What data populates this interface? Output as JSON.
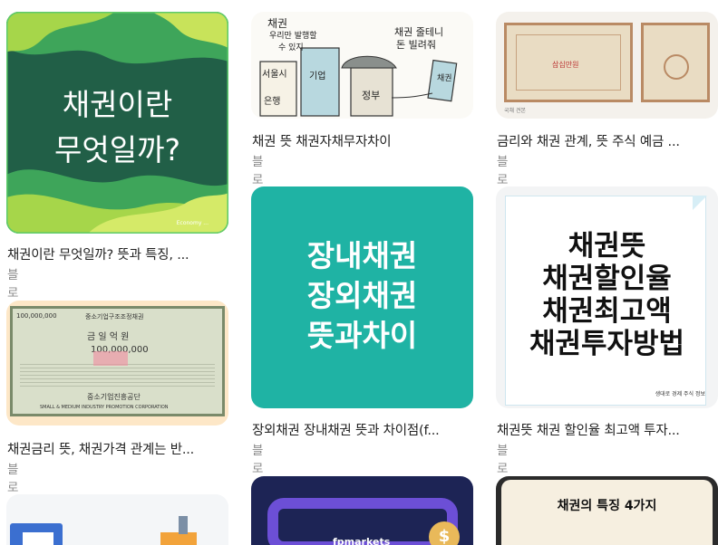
{
  "results": [
    {
      "title": "채권이란 무엇일까? 뜻과 특징, ...",
      "source": "블로그",
      "thumb_text": [
        "채권이란",
        "무엇일까?"
      ],
      "thumb_footer": "Economy ..."
    },
    {
      "title": "채권 뜻 채권자채무자차이",
      "source": "블로그",
      "thumb_labels": [
        "채권",
        "우리만 발행할",
        "수 있지",
        "채권 줄테니",
        "돈 빌려줘",
        "서울시",
        "은행",
        "기업",
        "정부",
        "채권"
      ]
    },
    {
      "title": "금리와 채권 관계, 뜻 주식 예금 ...",
      "source": "블로그",
      "thumb_labels": [
        "삼십만원",
        "국채 견본"
      ]
    },
    {
      "title": "채권금리 뜻, 채권가격 관계는 반...",
      "source": "블로그",
      "thumb_labels": [
        "100,000,000",
        "중소기업구조조정채권",
        "금 일 억 원",
        "100,000,000",
        "중소기업진흥공단",
        "SMALL & MEDIUM INDUSTRY PROMOTION CORPORATION"
      ]
    },
    {
      "title": "장외채권 장내채권 뜻과 차이점(f...",
      "source": "블로그",
      "thumb_text": [
        "장내채권",
        "장외채권",
        "뜻과차이"
      ]
    },
    {
      "title": "채권뜻 채권 할인율 최고액 투자...",
      "source": "블로그",
      "thumb_text": [
        "채권뜻",
        "채권할인율",
        "채권최고액",
        "채권투자방법"
      ],
      "thumb_footer": "생대로 경제 주식 정보"
    },
    {
      "thumb_labels": []
    },
    {
      "thumb_labels": [
        "fpmarkets"
      ]
    },
    {
      "thumb_text": [
        "채권의 특징 4가지"
      ]
    }
  ],
  "colors": {
    "teal": "#1fb3a4",
    "green": "#2f8a55",
    "card_bg": "#f3f1ea"
  }
}
